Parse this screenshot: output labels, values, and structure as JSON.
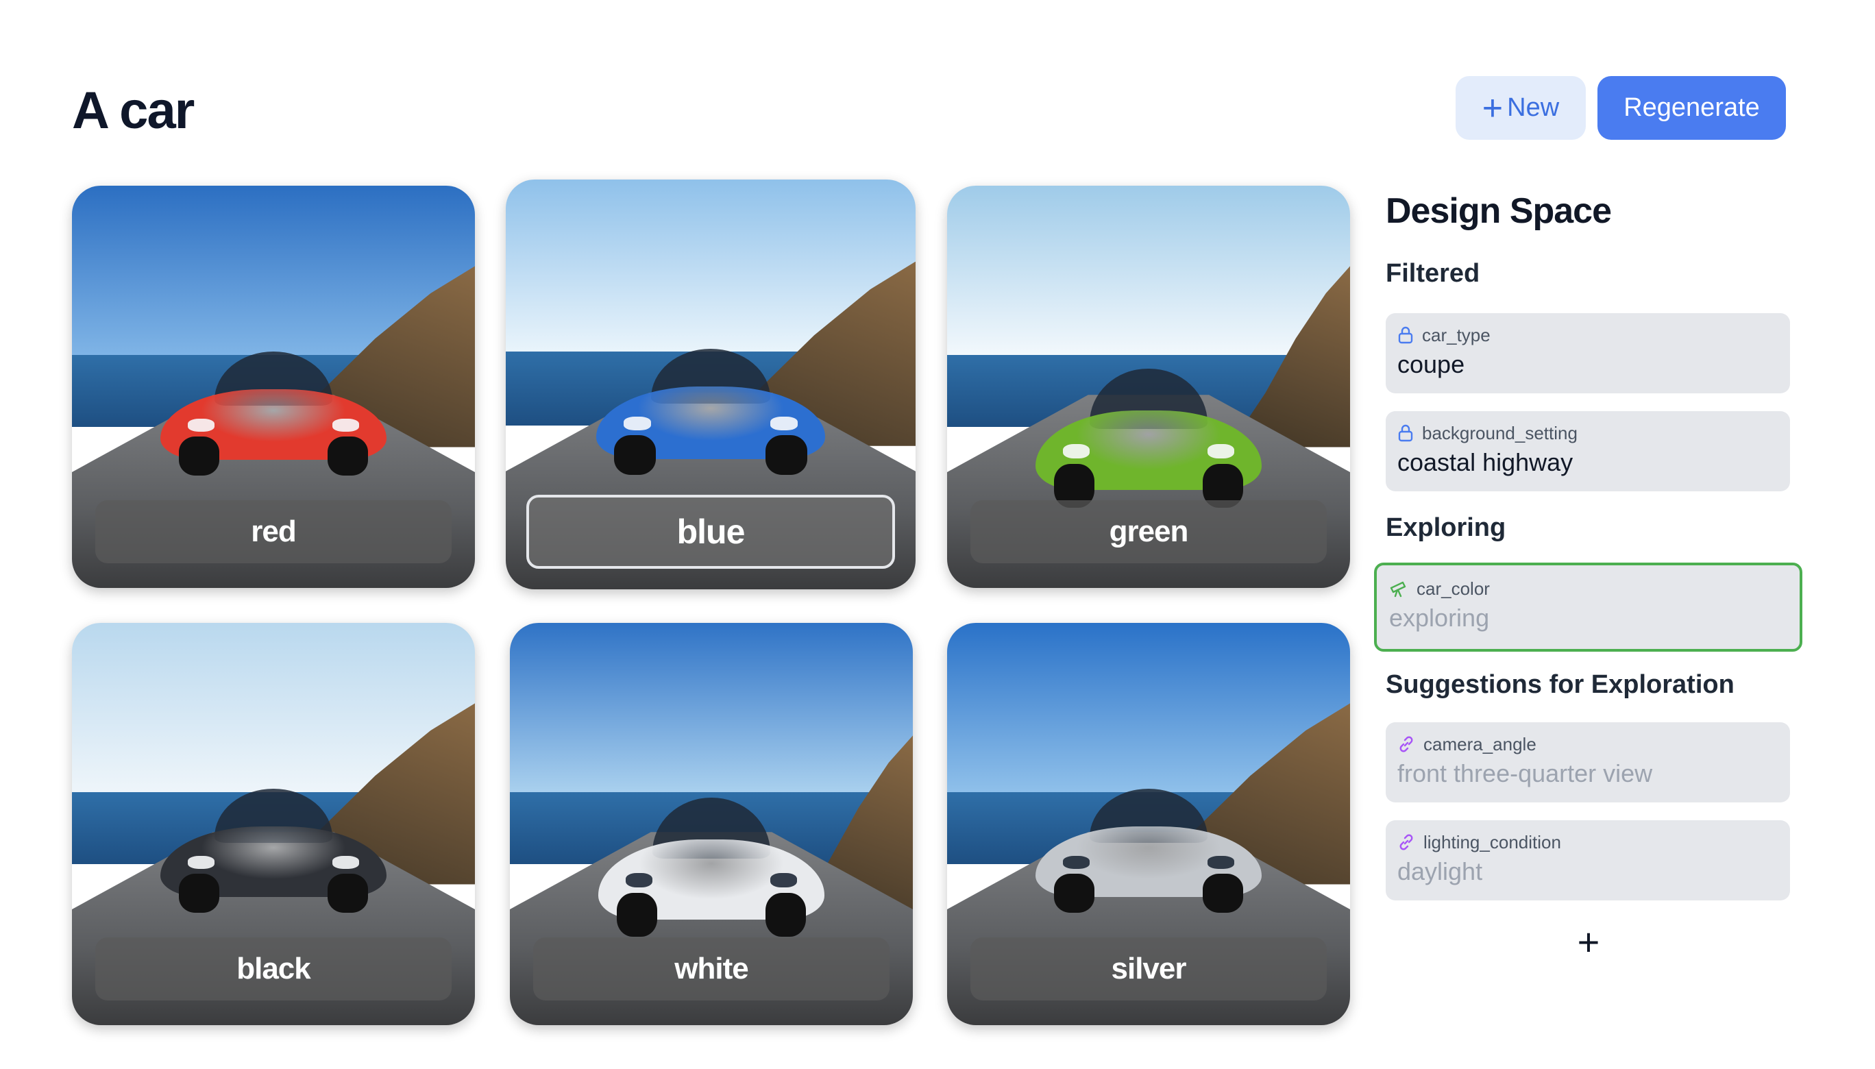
{
  "page": {
    "title": "A car"
  },
  "toolbar": {
    "new_label": "New",
    "regenerate_label": "Regenerate"
  },
  "gallery": [
    {
      "label": "red",
      "car_color": "#e23a2e",
      "sky": "#3f86cf",
      "highlighted": false
    },
    {
      "label": "blue",
      "car_color": "#2c6fd0",
      "sky": "#bcdcf2",
      "highlighted": true
    },
    {
      "label": "green",
      "car_color": "#6fb52c",
      "sky": "#cfe6f3",
      "highlighted": false
    },
    {
      "label": "black",
      "car_color": "#2f3238",
      "sky": "#cfe4f0",
      "highlighted": false
    },
    {
      "label": "white",
      "car_color": "#e8eaed",
      "sky": "#3d7fcf",
      "highlighted": false
    },
    {
      "label": "silver",
      "car_color": "#c3c7cc",
      "sky": "#2f7fd3",
      "highlighted": false
    }
  ],
  "design_space": {
    "title": "Design Space",
    "filtered_heading": "Filtered",
    "filtered": [
      {
        "key": "car_type",
        "value": "coupe",
        "icon": "lock-icon"
      },
      {
        "key": "background_setting",
        "value": "coastal highway",
        "icon": "lock-icon"
      }
    ],
    "exploring_heading": "Exploring",
    "exploring": [
      {
        "key": "car_color",
        "value": "exploring",
        "icon": "telescope-icon",
        "accent": "#4caf50"
      }
    ],
    "suggestions_heading": "Suggestions for Exploration",
    "suggestions": [
      {
        "key": "camera_angle",
        "value": "front three-quarter view",
        "icon": "link-icon"
      },
      {
        "key": "lighting_condition",
        "value": "daylight",
        "icon": "link-icon"
      }
    ],
    "add_label": "+"
  },
  "colors": {
    "primary": "#4a7cf0",
    "primary_light": "#e3ecfb",
    "exploring_border": "#4caf50",
    "chip_bg": "#e5e7eb"
  }
}
